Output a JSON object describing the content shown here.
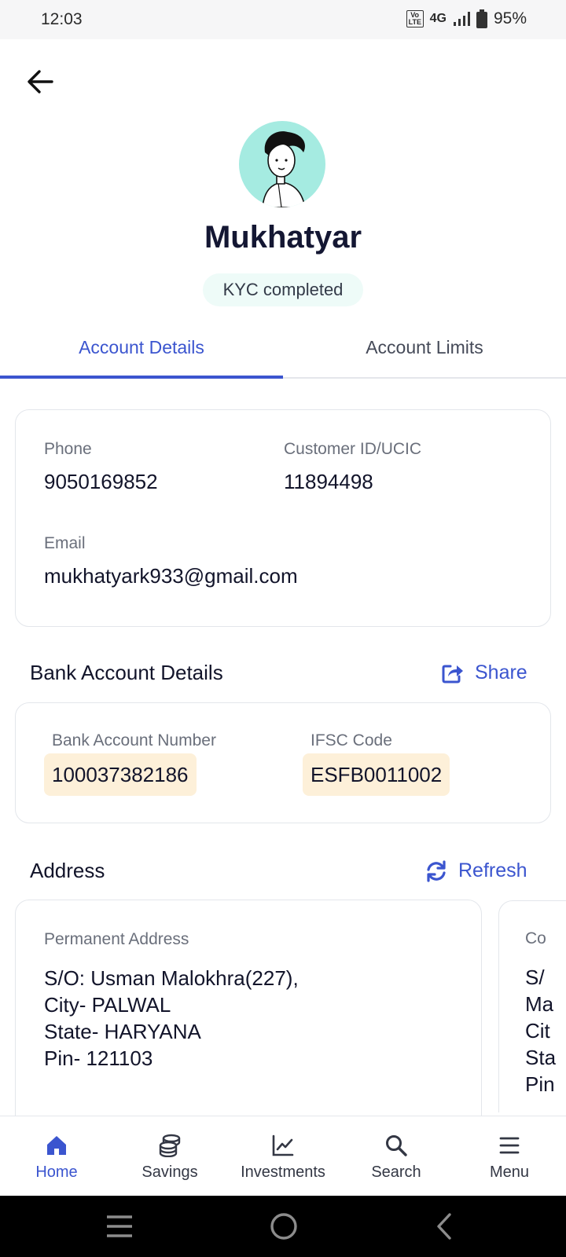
{
  "status_bar": {
    "time": "12:03",
    "volte": "VoLTE",
    "network": "4G",
    "battery": "95%"
  },
  "profile": {
    "name": "Mukhatyar",
    "kyc_status": "KYC completed"
  },
  "tabs": [
    {
      "label": "Account Details",
      "active": true
    },
    {
      "label": "Account Limits",
      "active": false
    }
  ],
  "contact": {
    "phone_label": "Phone",
    "phone_value": "9050169852",
    "customer_id_label": "Customer ID/UCIC",
    "customer_id_value": "11894498",
    "email_label": "Email",
    "email_value": "mukhatyark933@gmail.com"
  },
  "bank": {
    "title": "Bank Account Details",
    "share_label": "Share",
    "account_number_label": "Bank Account Number",
    "account_number_value": "100037382186",
    "ifsc_label": "IFSC Code",
    "ifsc_value": "ESFB0011002"
  },
  "address": {
    "title": "Address",
    "refresh_label": "Refresh",
    "permanent": {
      "label": "Permanent Address",
      "lines": [
        "S/O: Usman Malokhra(227),",
        "City- PALWAL",
        "State- HARYANA",
        "Pin- 121103"
      ]
    },
    "second_partial": {
      "label": "Co",
      "lines": [
        "S/",
        "Ma",
        "Cit",
        "Sta",
        "Pin"
      ]
    }
  },
  "bottom_nav": [
    {
      "label": "Home",
      "icon": "home-icon",
      "active": true
    },
    {
      "label": "Savings",
      "icon": "coins-icon",
      "active": false
    },
    {
      "label": "Investments",
      "icon": "chart-line-icon",
      "active": false
    },
    {
      "label": "Search",
      "icon": "search-icon",
      "active": false
    },
    {
      "label": "Menu",
      "icon": "menu-icon",
      "active": false
    }
  ],
  "colors": {
    "accent": "#3b55cf",
    "highlight": "#fdf0d9",
    "avatar_bg": "#a5ebe1",
    "kyc_bg": "#eefbf8"
  }
}
